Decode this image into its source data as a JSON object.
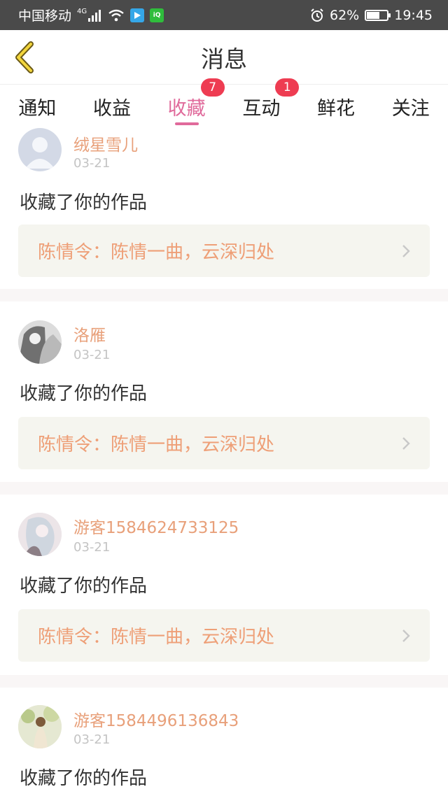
{
  "status_bar": {
    "carrier": "中国移动",
    "network": "4G",
    "battery": "62%",
    "battery_level": 0.62,
    "time": "19:45"
  },
  "header": {
    "title": "消息"
  },
  "tabs": [
    {
      "label": "通知",
      "active": false
    },
    {
      "label": "收益",
      "active": false
    },
    {
      "label": "收藏",
      "active": true,
      "badge": "7"
    },
    {
      "label": "互动",
      "active": false,
      "badge": "1"
    },
    {
      "label": "鲜花",
      "active": false
    },
    {
      "label": "关注",
      "active": false
    }
  ],
  "items": [
    {
      "username": "绒星雪儿",
      "date": "03-21",
      "action": "收藏了你的作品",
      "work": "陈情令：陈情一曲，云深归处"
    },
    {
      "username": "洛雁",
      "date": "03-21",
      "action": "收藏了你的作品",
      "work": "陈情令：陈情一曲，云深归处"
    },
    {
      "username": "游客1584624733125",
      "date": "03-21",
      "action": "收藏了你的作品",
      "work": "陈情令：陈情一曲，云深归处"
    },
    {
      "username": "游客1584496136843",
      "date": "03-21",
      "action": "收藏了你的作品",
      "work": ""
    }
  ],
  "colors": {
    "accent": "#e06a9b",
    "badge": "#ee3c52",
    "username": "#e8a07a",
    "work_title": "#ee9f77"
  }
}
